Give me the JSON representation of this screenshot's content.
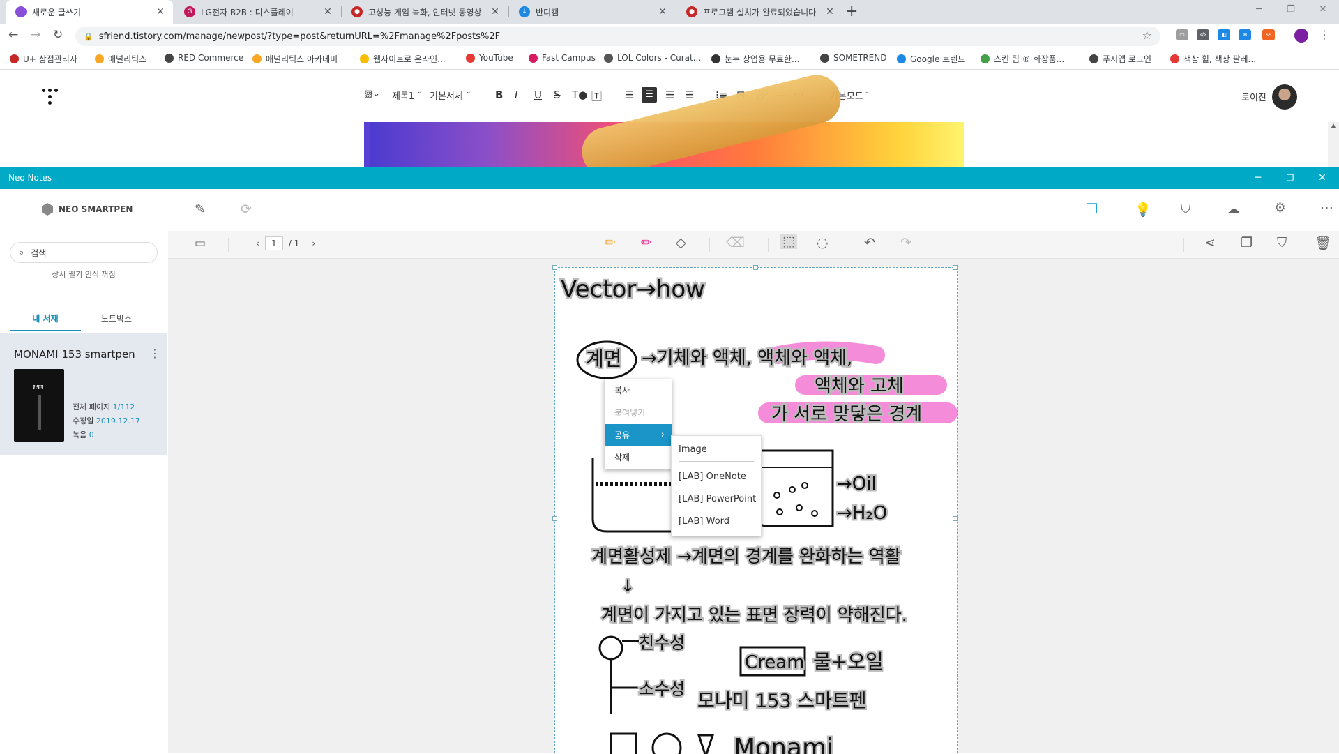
{
  "browser": {
    "tabs": [
      {
        "title": "새로운 글쓰기",
        "color": "#8a4fd8",
        "active": true
      },
      {
        "title": "LG전자 B2B : 디스플레이",
        "color": "#c2185b",
        "active": false
      },
      {
        "title": "고성능 게임 녹화, 인터넷 동영상",
        "color": "#c62828",
        "active": false
      },
      {
        "title": "반디캠",
        "color": "#1e88e5",
        "active": false
      },
      {
        "title": "프로그램 설치가 완료되었습니다",
        "color": "#c62828",
        "active": false
      }
    ],
    "url": "sfriend.tistory.com/manage/newpost/?type=post&returnURL=%2Fmanage%2Fposts%2F",
    "bookmarks": [
      {
        "label": "U+ 상점관리자",
        "color": "#c62828"
      },
      {
        "label": "애널리틱스",
        "color": "#f9a825"
      },
      {
        "label": "RED Commerce",
        "color": "#444444"
      },
      {
        "label": "애널리틱스 아카데미",
        "color": "#f9a825"
      },
      {
        "label": "웹사이트로 온라인...",
        "color": "#fbbc04"
      },
      {
        "label": "YouTube",
        "color": "#e53935"
      },
      {
        "label": "Fast Campus",
        "color": "#d81b60"
      },
      {
        "label": "LOL Colors - Curat...",
        "color": "#555555"
      },
      {
        "label": "눈누 상업용 무료한...",
        "color": "#333333"
      },
      {
        "label": "SOMETREND",
        "color": "#444444"
      },
      {
        "label": "Google 트렌드",
        "color": "#1e88e5"
      },
      {
        "label": "스킨 팁 ® 화장품...",
        "color": "#43a047"
      },
      {
        "label": "푸시앱 로그인",
        "color": "#444444"
      },
      {
        "label": "색상 휠, 색상 팔레...",
        "color": "#e53935"
      }
    ]
  },
  "editor": {
    "toolbar": {
      "heading": "제목1",
      "font": "기본서체",
      "bold": "B",
      "italic": "I",
      "underline": "U",
      "strike": "S",
      "mode": "기본모드"
    },
    "user": "로이진"
  },
  "neo": {
    "window_title": "Neo Notes",
    "brand": "NEO SMARTPEN",
    "search_placeholder": "검색",
    "hw_status": "상시 필기 인식 꺼짐",
    "tabs": [
      "내 서재",
      "노트박스"
    ],
    "notebook": {
      "title": "MONAMI 153 smartpen",
      "cover_text": "153",
      "total_label": "전체 페이지",
      "total_value": "1/112",
      "modified_label": "수정일",
      "modified_value": "2019.12.17",
      "record_label": "녹음",
      "record_value": "0"
    },
    "pager": {
      "current": "1",
      "total": "/ 1"
    },
    "context_menu": {
      "items": [
        "복사",
        "붙여넣기",
        "공유",
        "삭제"
      ],
      "share_submenu": [
        "Image",
        "[LAB] OneNote",
        "[LAB] PowerPoint",
        "[LAB] Word"
      ]
    },
    "note": {
      "lines": [
        "Vector→how",
        "계면",
        "→기체와 액체, 액체와 액체,",
        "액체와 고체",
        "가 서로 맞닿은 경계",
        "→Oil",
        "→H₂O",
        "계면활성제 →계면의 경계를 완화하는 역활",
        "↓",
        "계면이 가지고 있는 표면 장력이 약해진다.",
        "친수성",
        "소수성",
        "Cream",
        "물+오일",
        "모나미 153 스마트펜",
        "Monami"
      ]
    }
  }
}
